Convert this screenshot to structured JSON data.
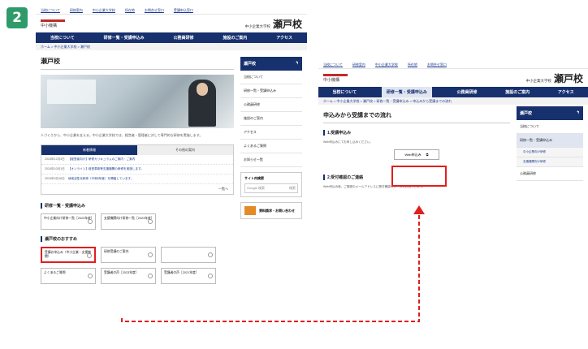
{
  "step_number": "2",
  "topbar_links": [
    "当校について",
    "研修案内",
    "中小企業大学校",
    "所在地",
    "お問合せ窓口",
    "受講申込窓口"
  ],
  "logo_text": "中小機構",
  "school": {
    "prefix": "中小企業大学校",
    "name": "瀬戸校"
  },
  "gnav": [
    "当校について",
    "研修一覧・受講申込み",
    "公務員研修",
    "施設のご案内",
    "アクセス"
  ],
  "breadcrumb_1": "ホーム > 中小企業大学校 > 瀬戸校",
  "page1": {
    "title": "瀬戸校",
    "intro": "人づくりから、中小企業を支える。中小企業大学校では、経営者・管理者に対して専門的な研修を実施します。",
    "news_tabs": [
      "新着情報",
      "その他の案内"
    ],
    "news_rows": [
      {
        "date": "2024年12月3日",
        "text": "【経営者向け】研修カリキュラムのご案内・ご案内"
      },
      {
        "date": "2024年10月1日",
        "text": "【オンライン】経営革新等支援機関の研修を実施します。"
      },
      {
        "date": "2024年9月16日",
        "text": "地域活性化研修〈令和6年度〉を開催しています。"
      }
    ],
    "news_more": "一覧へ",
    "section_courses": "研修一覧・受講申込み",
    "course_cards": [
      "中小企業向け研修一覧［2023年度］",
      "支援機関向け研修一覧［2023年度］"
    ],
    "section_recommend": "瀬戸校のおすすめ",
    "recommend_cards": [
      "受講お申込み（中小企業・支援機関）",
      "研修受講のご案内",
      "",
      "よくあるご質問",
      "受講者の声［2023年度］",
      "受講者の声［2021年度］"
    ]
  },
  "sidebar1": {
    "title": "瀬戸校",
    "items": [
      "当校について",
      "研修一覧・受講申込み",
      "公務員研修",
      "施設のご案内",
      "アクセス",
      "よくあるご質問",
      "お知らせ一覧"
    ],
    "search_label": "サイト内検索",
    "search_placeholder": "Google 検索",
    "search_button": "検索",
    "contact": "資料請求・お問い合わせ"
  },
  "breadcrumb_2": "ホーム > 中小企業大学校 > 瀬戸校 > 研修一覧・受講申込み > 申込みから受講までの流れ",
  "page2": {
    "title": "申込みから受講までの流れ",
    "step1": "1.受講申込み",
    "step1_text": "Web申込みにてお申し込みください。",
    "web_button": "Web申込み",
    "step2": "2.受付確認のご連絡",
    "step2_text": "Web申込み後、ご登録のメールアドレスに受付確認のメールをお送りします。"
  },
  "sidebar2": {
    "title": "瀬戸校",
    "items": [
      "当校について",
      "研修一覧・受講申込み"
    ],
    "subitems": [
      "中小企業向け研修",
      "支援機関向け研修"
    ],
    "after": [
      "公務員研修"
    ]
  },
  "colors": {
    "navy": "#17306e",
    "highlight": "#e11e1e",
    "badge": "#2f9b6a"
  }
}
